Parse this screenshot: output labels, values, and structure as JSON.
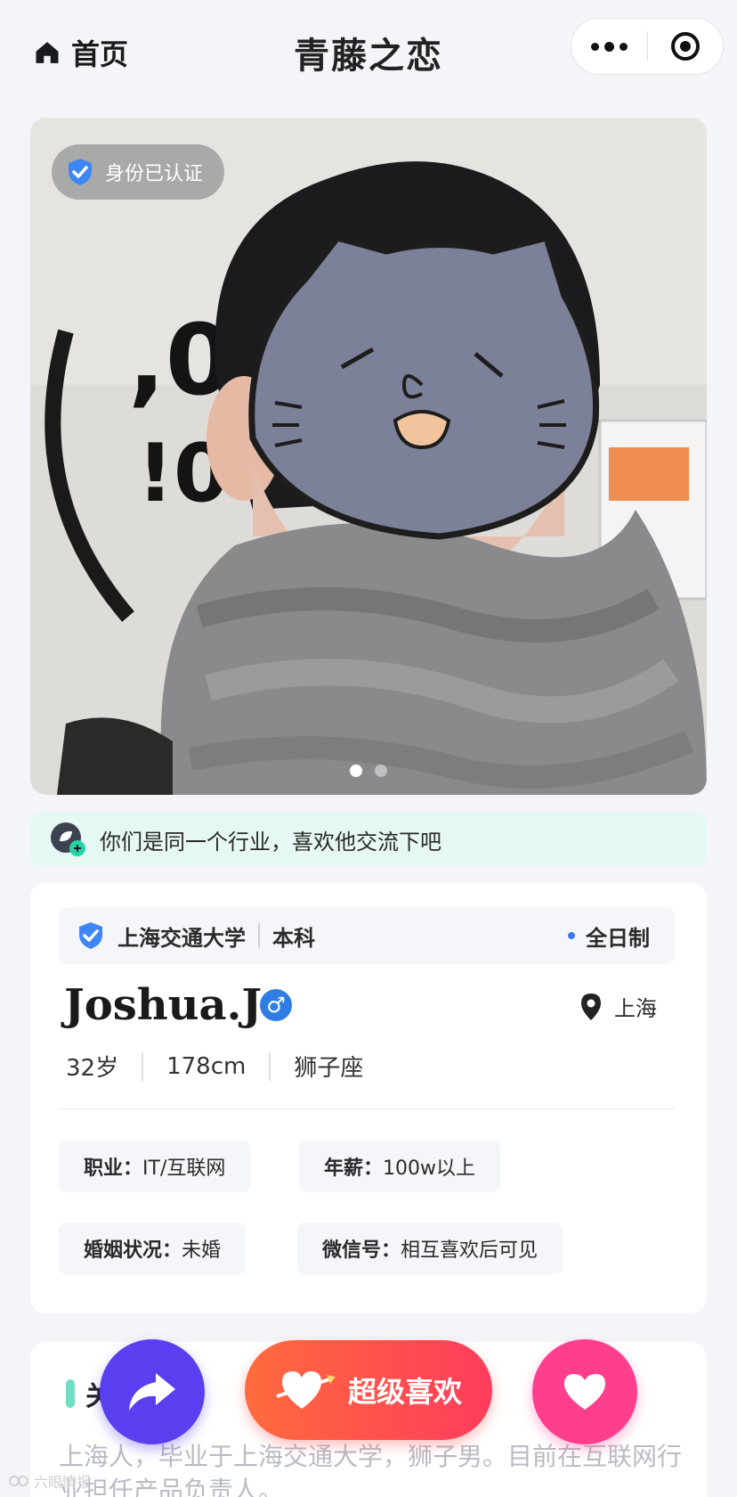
{
  "header": {
    "home_label": "首页",
    "title": "青藤之恋"
  },
  "photo": {
    "verified_label": "身份已认证",
    "image_count": 2,
    "active_index": 0
  },
  "tip": {
    "text": "你们是同一个行业，喜欢他交流下吧"
  },
  "profile": {
    "school": "上海交通大学",
    "degree": "本科",
    "study_mode": "全日制",
    "name": "Joshua.J",
    "gender_symbol": "♂",
    "location": "上海",
    "age": "32岁",
    "height": "178cm",
    "zodiac": "狮子座",
    "tags": [
      {
        "key": "职业：",
        "value": "IT/互联网"
      },
      {
        "key": "年薪：",
        "value": "100w以上"
      },
      {
        "key": "婚姻状况：",
        "value": "未婚"
      },
      {
        "key": "微信号：",
        "value": "相互喜欢后可见"
      }
    ]
  },
  "about": {
    "heading_visible": "关",
    "text": "上海人，毕业于上海交通大学，狮子男。目前在互联网行业担任产品负责人。"
  },
  "actions": {
    "super_like_label": "超级喜欢"
  },
  "watermark": {
    "text": "六眼情报"
  },
  "colors": {
    "share_button": "#5a3ff0",
    "super_like_gradient_start": "#ff6b3d",
    "super_like_gradient_end": "#ff3c5c",
    "like_button": "#ff3f8e",
    "verified_blue": "#2f7de3",
    "tip_background": "#e6f8f3"
  }
}
